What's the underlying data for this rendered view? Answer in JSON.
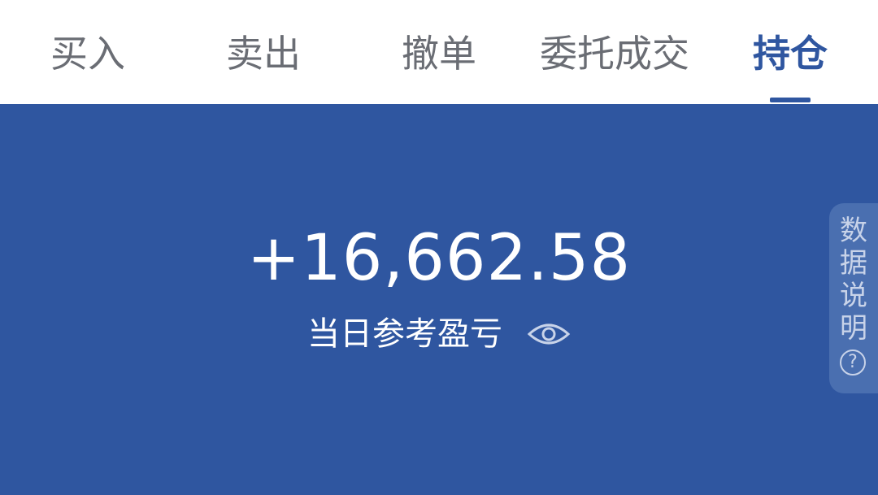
{
  "tabs": [
    {
      "label": "买入",
      "active": false
    },
    {
      "label": "卖出",
      "active": false
    },
    {
      "label": "撤单",
      "active": false
    },
    {
      "label": "委托成交",
      "active": false
    },
    {
      "label": "持仓",
      "active": true
    }
  ],
  "summary": {
    "pnl_value": "+16,662.58",
    "pnl_label": "当日参考盈亏",
    "visibility_icon": "eye-icon"
  },
  "side_tab": {
    "chars": [
      "数",
      "据",
      "说",
      "明"
    ],
    "help_symbol": "?"
  },
  "colors": {
    "brand": "#2f56a0",
    "tab_text": "#6a6d74",
    "panel_text": "#ffffff"
  }
}
